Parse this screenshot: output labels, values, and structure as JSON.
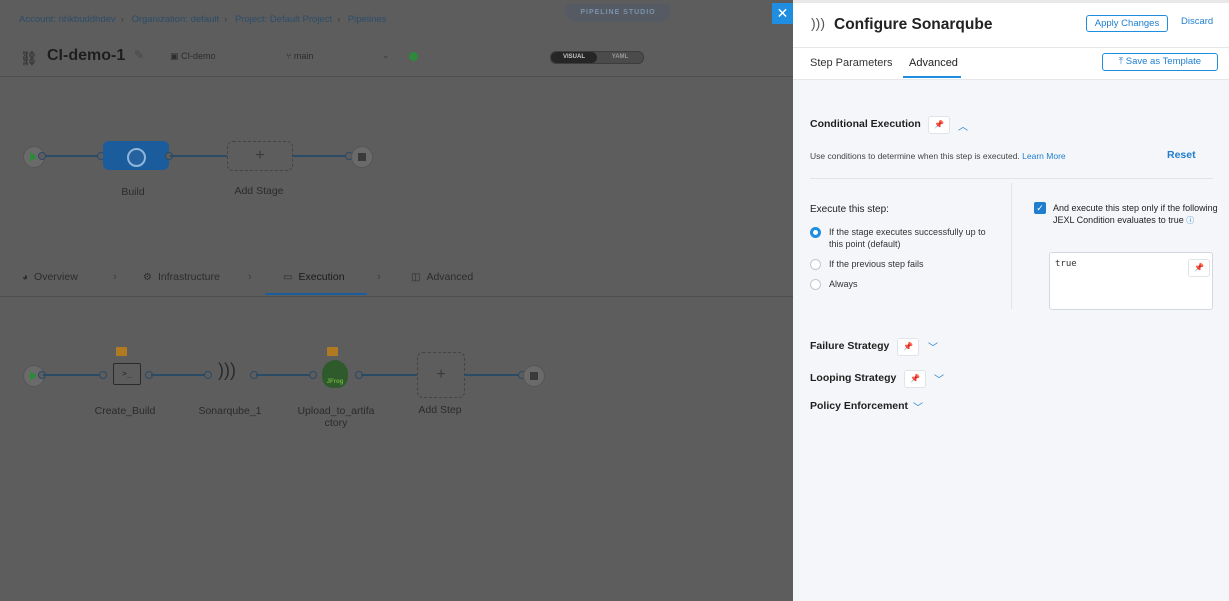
{
  "breadcrumb": [
    "Account: nhkbuddhdev",
    "Organization: default",
    "Project: Default Project",
    "Pipelines"
  ],
  "studio_label": "PIPELINE STUDIO",
  "pipeline": {
    "name": "CI-demo-1",
    "repo": "CI-demo",
    "branch": "main",
    "view_toggle": {
      "visual": "VISUAL",
      "yaml": "YAML"
    }
  },
  "stages": {
    "build": "Build",
    "add": "Add Stage"
  },
  "stage_tabs": [
    "Overview",
    "Infrastructure",
    "Execution",
    "Advanced"
  ],
  "steps": {
    "create_build": "Create_Build",
    "sonarqube": "Sonarqube_1",
    "upload_line1": "Upload_to_artifa",
    "upload_line2": "ctory",
    "add": "Add Step",
    "jfrog_text": "JFrog"
  },
  "drawer": {
    "title": "Configure Sonarqube",
    "apply": "Apply Changes",
    "discard": "Discard",
    "tabs": [
      "Step Parameters",
      "Advanced"
    ],
    "active_tab": "Advanced",
    "save_template": "Save as Template",
    "conditional": {
      "title": "Conditional Execution",
      "desc": "Use conditions to determine when this step is executed.",
      "learn_more": "Learn More",
      "reset": "Reset",
      "execute_title": "Execute this step:",
      "options": [
        "If the stage executes successfully up to this point (default)",
        "If the previous step fails",
        "Always"
      ],
      "selected": 0,
      "jexl_checkbox_label": "And execute this step only if the following JEXL Condition evaluates to true",
      "jexl_checked": true,
      "jexl_value": "true"
    },
    "sections": [
      "Failure Strategy",
      "Looping Strategy",
      "Policy Enforcement"
    ]
  },
  "colors": {
    "accent": "#1f8ee0",
    "stage_blue": "#1a5c9c",
    "status_green": "#2d8a3a"
  }
}
